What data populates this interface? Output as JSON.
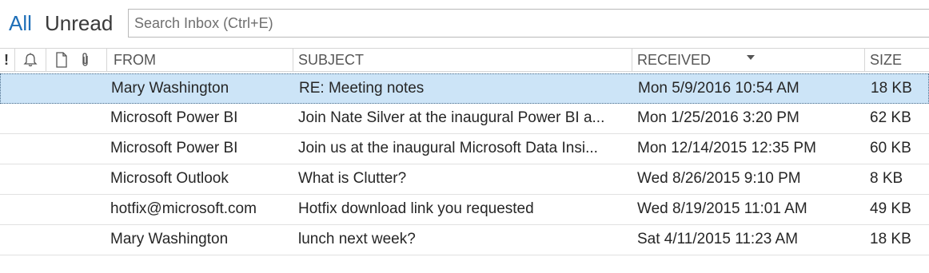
{
  "filters": {
    "all": "All",
    "unread": "Unread"
  },
  "search": {
    "placeholder": "Search Inbox (Ctrl+E)"
  },
  "columns": {
    "importance": "!",
    "reminder_icon": "bell-icon",
    "attachment_doc_icon": "document-icon",
    "attachment_icon": "paperclip-icon",
    "from": "FROM",
    "subject": "SUBJECT",
    "received": "RECEIVED",
    "size": "SIZE"
  },
  "sort": {
    "column": "received",
    "direction": "descending"
  },
  "colors": {
    "accent": "#1e6fb8",
    "selected_row": "#cce4f7"
  },
  "messages": [
    {
      "from": "Mary Washington",
      "subject": "RE: Meeting notes",
      "received": "Mon 5/9/2016 10:54 AM",
      "size": "18 KB",
      "selected": true
    },
    {
      "from": "Microsoft Power BI",
      "subject": "Join Nate Silver at the inaugural Power BI a...",
      "received": "Mon 1/25/2016 3:20 PM",
      "size": "62 KB",
      "selected": false
    },
    {
      "from": "Microsoft Power BI",
      "subject": "Join us at the inaugural Microsoft Data Insi...",
      "received": "Mon 12/14/2015 12:35 PM",
      "size": "60 KB",
      "selected": false
    },
    {
      "from": "Microsoft Outlook",
      "subject": "What is Clutter?",
      "received": "Wed 8/26/2015 9:10 PM",
      "size": "8 KB",
      "selected": false
    },
    {
      "from": "hotfix@microsoft.com",
      "subject": "Hotfix download link you requested",
      "received": "Wed 8/19/2015 11:01 AM",
      "size": "49 KB",
      "selected": false
    },
    {
      "from": "Mary Washington",
      "subject": "lunch next week?",
      "received": "Sat 4/11/2015 11:23 AM",
      "size": "18 KB",
      "selected": false
    }
  ]
}
